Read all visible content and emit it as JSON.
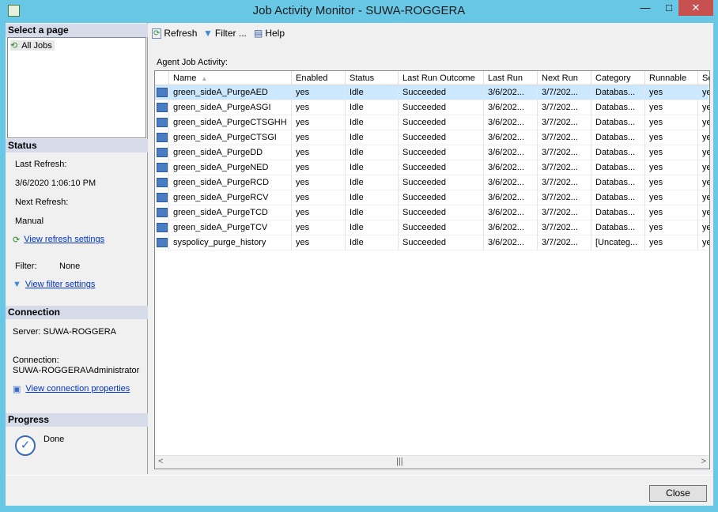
{
  "window": {
    "title": "Job Activity Monitor - SUWA-ROGGERA",
    "minimize": "—",
    "maximize": "□",
    "close": "✕"
  },
  "left": {
    "select_page": "Select a page",
    "pages": [
      "All Jobs"
    ],
    "status_header": "Status",
    "last_refresh_label": "Last Refresh:",
    "last_refresh": "3/6/2020 1:06:10 PM",
    "next_refresh_label": "Next Refresh:",
    "next_refresh": "Manual",
    "view_refresh": "View refresh settings",
    "filter_label": "Filter:",
    "filter_value": "None",
    "view_filter": "View filter settings",
    "connection_header": "Connection",
    "server": "Server: SUWA-ROGGERA",
    "connection_label": "Connection:",
    "connection": "SUWA-ROGGERA\\Administrator",
    "view_connection": "View connection properties",
    "progress_header": "Progress",
    "progress": "Done"
  },
  "toolbar": {
    "refresh": "Refresh",
    "filter": "Filter ...",
    "help": "Help"
  },
  "grid": {
    "label": "Agent Job Activity:",
    "columns": [
      "Name",
      "Enabled",
      "Status",
      "Last Run Outcome",
      "Last Run",
      "Next Run",
      "Category",
      "Runnable",
      "Sc"
    ],
    "sort_indicator": "▲",
    "rows": [
      [
        "green_sideA_PurgeAED",
        "yes",
        "Idle",
        "Succeeded",
        "3/6/202...",
        "3/7/202...",
        "Databas...",
        "yes",
        "ye"
      ],
      [
        "green_sideA_PurgeASGI",
        "yes",
        "Idle",
        "Succeeded",
        "3/6/202...",
        "3/7/202...",
        "Databas...",
        "yes",
        "ye"
      ],
      [
        "green_sideA_PurgeCTSGHH",
        "yes",
        "Idle",
        "Succeeded",
        "3/6/202...",
        "3/7/202...",
        "Databas...",
        "yes",
        "ye"
      ],
      [
        "green_sideA_PurgeCTSGI",
        "yes",
        "Idle",
        "Succeeded",
        "3/6/202...",
        "3/7/202...",
        "Databas...",
        "yes",
        "ye"
      ],
      [
        "green_sideA_PurgeDD",
        "yes",
        "Idle",
        "Succeeded",
        "3/6/202...",
        "3/7/202...",
        "Databas...",
        "yes",
        "ye"
      ],
      [
        "green_sideA_PurgeNED",
        "yes",
        "Idle",
        "Succeeded",
        "3/6/202...",
        "3/7/202...",
        "Databas...",
        "yes",
        "ye"
      ],
      [
        "green_sideA_PurgeRCD",
        "yes",
        "Idle",
        "Succeeded",
        "3/6/202...",
        "3/7/202...",
        "Databas...",
        "yes",
        "ye"
      ],
      [
        "green_sideA_PurgeRCV",
        "yes",
        "Idle",
        "Succeeded",
        "3/6/202...",
        "3/7/202...",
        "Databas...",
        "yes",
        "ye"
      ],
      [
        "green_sideA_PurgeTCD",
        "yes",
        "Idle",
        "Succeeded",
        "3/6/202...",
        "3/7/202...",
        "Databas...",
        "yes",
        "ye"
      ],
      [
        "green_sideA_PurgeTCV",
        "yes",
        "Idle",
        "Succeeded",
        "3/6/202...",
        "3/7/202...",
        "Databas...",
        "yes",
        "ye"
      ],
      [
        "syspolicy_purge_history",
        "yes",
        "Idle",
        "Succeeded",
        "3/6/202...",
        "3/7/202...",
        "[Uncateg...",
        "yes",
        "ye"
      ]
    ]
  },
  "footer": {
    "close": "Close"
  },
  "colors": {
    "titlebar": "#69c7e6",
    "selection": "#cce8ff",
    "section": "#d6dbe9",
    "close_button": "#c75050"
  }
}
